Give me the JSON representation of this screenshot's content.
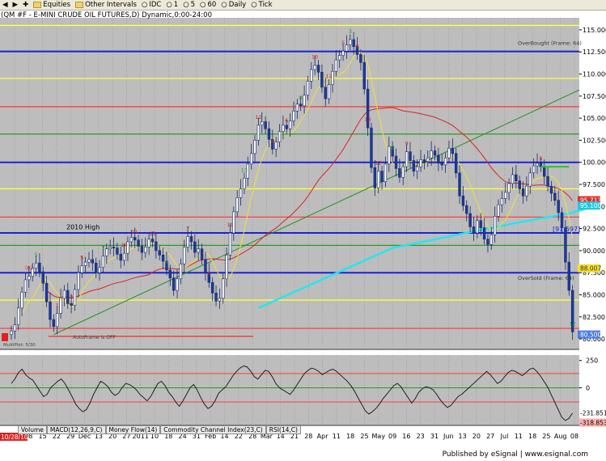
{
  "toolbar": {
    "items": [
      {
        "label": "Equities",
        "icon": "folder-icon"
      },
      {
        "label": "Other Intervals",
        "icon": "folder-icon"
      },
      {
        "label": "IDC",
        "icon": "radio-icon"
      },
      {
        "label": "1",
        "icon": "radio-icon"
      },
      {
        "label": "5",
        "icon": "radio-icon"
      },
      {
        "label": "60",
        "icon": "radio-icon"
      },
      {
        "label": "Daily",
        "icon": "radio-icon"
      },
      {
        "label": "Tick",
        "icon": "radio-icon"
      }
    ]
  },
  "chart_title": "(QM #F - E-MINI CRUDE OIL FUTURES,D) Dynamic,0:00-24:00",
  "chart_data": {
    "type": "candlestick",
    "price_axis": {
      "ylim": [
        79.0,
        116.0
      ],
      "ticks": [
        "115.000",
        "112.500",
        "110.000",
        "107.500",
        "105.000",
        "102.500",
        "100.000",
        "97.500",
        "95.000",
        "92.500",
        "90.000",
        "87.500",
        "85.000",
        "82.500",
        "80.000"
      ]
    },
    "x_labels": [
      "Nov",
      "08",
      "15",
      "22",
      "29",
      "Dec",
      "13",
      "20",
      "27",
      "2011",
      "10",
      "18",
      "24",
      "31",
      "Feb",
      "14",
      "22",
      "28",
      "Mar",
      "14",
      "21",
      "28",
      "Apr",
      "11",
      "18",
      "25",
      "May",
      "09",
      "16",
      "23",
      "31",
      "Jun",
      "13",
      "20",
      "27",
      "Jul",
      "11",
      "18",
      "25",
      "Aug",
      "08"
    ],
    "date_badge": "10/28/10",
    "closes": [
      80.9,
      81.6,
      83.5,
      85.3,
      86.7,
      87.1,
      88.0,
      88.6,
      87.6,
      86.3,
      84.2,
      82.2,
      81.4,
      82.9,
      84.6,
      85.5,
      84.0,
      83.8,
      85.6,
      87.5,
      88.3,
      88.7,
      89.0,
      88.6,
      87.5,
      88.1,
      89.4,
      90.2,
      90.4,
      90.3,
      89.6,
      88.9,
      89.7,
      91.0,
      91.5,
      91.2,
      90.5,
      89.8,
      90.4,
      91.3,
      91.0,
      90.0,
      89.5,
      88.8,
      87.8,
      86.9,
      85.5,
      86.8,
      88.5,
      90.4,
      91.6,
      91.0,
      89.8,
      90.2,
      89.0,
      87.5,
      86.4,
      85.2,
      84.3,
      84.6,
      86.8,
      89.5,
      92.0,
      94.4,
      96.0,
      97.0,
      98.2,
      99.8,
      101.0,
      102.5,
      104.2,
      104.6,
      103.8,
      102.6,
      101.5,
      102.3,
      103.5,
      104.2,
      103.8,
      104.7,
      105.8,
      106.6,
      106.4,
      107.6,
      109.2,
      110.5,
      111.0,
      110.2,
      108.5,
      107.2,
      108.8,
      110.3,
      111.6,
      112.1,
      112.6,
      113.3,
      113.9,
      113.1,
      112.2,
      111.3,
      108.3,
      103.9,
      99.4,
      97.1,
      99.0,
      97.8,
      99.8,
      101.8,
      100.7,
      99.3,
      98.3,
      99.5,
      101.2,
      100.2,
      99.0,
      99.5,
      100.3,
      100.1,
      100.5,
      101.3,
      100.8,
      99.9,
      99.7,
      100.5,
      101.6,
      101.0,
      98.8,
      96.2,
      95.1,
      94.2,
      92.7,
      92.0,
      93.4,
      92.6,
      91.3,
      90.7,
      91.8,
      93.9,
      95.2,
      95.9,
      96.6,
      97.6,
      98.6,
      97.9,
      97.0,
      96.2,
      97.3,
      98.8,
      99.6,
      99.9,
      99.5,
      98.4,
      97.3,
      96.5,
      95.7,
      94.3,
      92.6,
      88.7,
      85.5,
      80.8
    ],
    "horizontal_lines": [
      {
        "value": 115.5,
        "color": "#ffff44"
      },
      {
        "value": 112.55,
        "color": "#1a22d8"
      },
      {
        "value": 109.5,
        "color": "#ffff44"
      },
      {
        "value": 106.3,
        "color": "#ff4040"
      },
      {
        "value": 103.2,
        "color": "#2a9a2a"
      },
      {
        "value": 100.0,
        "color": "#1a22d8"
      },
      {
        "value": 97.0,
        "color": "#ffff44"
      },
      {
        "value": 93.8,
        "color": "#ff4040"
      },
      {
        "value": 92.0,
        "color": "#1a22d8"
      },
      {
        "value": 90.6,
        "color": "#2a9a2a"
      },
      {
        "value": 87.5,
        "color": "#1a22d8"
      },
      {
        "value": 84.4,
        "color": "#ffff44"
      },
      {
        "value": 81.2,
        "color": "#ff4040"
      }
    ],
    "annotations": {
      "overbought": "OverBought (Frame: 64)",
      "oversold": "OverSold (Frame: 64)",
      "high_2010": "2010 High",
      "autoframe": "AutoFrame is OFF",
      "multiplot": "MultiPlot: 5/30"
    },
    "price_flags": [
      {
        "label": "95.713",
        "bg": "#e03030",
        "value": 95.713
      },
      {
        "label": "95.100",
        "bg": "#20c8e0",
        "value": 95.1
      },
      {
        "label": "88.007",
        "bg": "#f5e030",
        "value": 88.007
      },
      {
        "label": "80.500",
        "bg": "#4b7be0",
        "value": 80.5
      }
    ],
    "bracket_label": "[91.597]",
    "sequence_labels": [
      "(R)",
      "5",
      "1",
      "3",
      "5",
      "7",
      "10",
      "11",
      "13",
      "4",
      "7",
      "5",
      "11",
      "13",
      "12",
      "4",
      "6",
      "8",
      "10",
      "12",
      "5",
      "3",
      "9",
      "13",
      "12",
      "8",
      "9",
      "H",
      "8",
      "12"
    ],
    "oscillator": {
      "ylim": [
        -330,
        270
      ],
      "ticks": [
        "250",
        "0"
      ],
      "flags": [
        {
          "label": "-231.851",
          "bg": "#ffffff",
          "value": -231.851
        },
        {
          "label": "-318.853",
          "bg": "#ffb0b0",
          "value": -318.853
        }
      ],
      "values": [
        40,
        80,
        140,
        170,
        120,
        90,
        70,
        20,
        -30,
        -80,
        -60,
        0,
        30,
        60,
        80,
        40,
        -20,
        -80,
        -150,
        -190,
        -220,
        -200,
        -140,
        -60,
        0,
        60,
        40,
        10,
        -40,
        -70,
        -50,
        0,
        40,
        30,
        10,
        -20,
        -60,
        -90,
        -120,
        -80,
        -20,
        40,
        60,
        20,
        -40,
        -80,
        -130,
        -170,
        -120,
        -60,
        0,
        30,
        -20,
        -90,
        -150,
        -190,
        -170,
        -120,
        -50,
        -20,
        10,
        60,
        110,
        150,
        180,
        200,
        190,
        150,
        100,
        80,
        120,
        160,
        150,
        100,
        40,
        0,
        -20,
        -40,
        -60,
        -20,
        30,
        80,
        130,
        160,
        180,
        170,
        150,
        120,
        140,
        160,
        170,
        150,
        120,
        90,
        60,
        20,
        -30,
        -90,
        -150,
        -210,
        -240,
        -220,
        -190,
        -150,
        -100,
        -60,
        -20,
        20,
        40,
        10,
        -40,
        -90,
        -140,
        -100,
        -40,
        -10,
        10,
        0,
        -20,
        -60,
        -110,
        -150,
        -180,
        -160,
        -120,
        -80,
        -60,
        -30,
        0,
        30,
        60,
        90,
        120,
        150,
        120,
        80,
        40,
        60,
        100,
        140,
        160,
        150,
        130,
        110,
        140,
        170,
        180,
        150,
        110,
        60,
        10,
        -60,
        -130,
        -200,
        -270,
        -300,
        -280,
        -231.851
      ]
    },
    "oscillator_lines": [
      {
        "value": 130,
        "color": "#ff4040"
      },
      {
        "value": 0,
        "color": "#2a9a2a"
      },
      {
        "value": -130,
        "color": "#ff4040"
      }
    ]
  },
  "indicator_tabs": [
    "Volume",
    "MACD(12,26,9,C)",
    "Money Flow(14)",
    "Commodity Channel Index(23,C)",
    "RSI(14,C)"
  ],
  "footer": "Published by eSignal | www.esignal.com"
}
